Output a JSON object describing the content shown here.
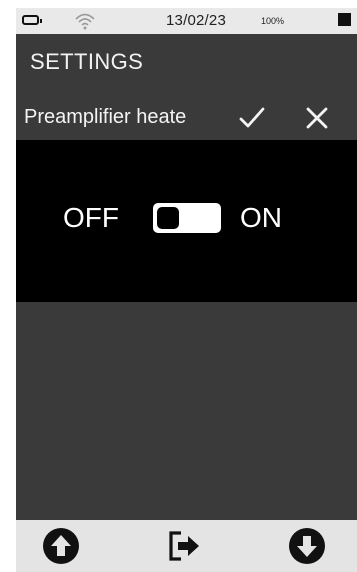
{
  "status_bar": {
    "date": "13/02/23",
    "battery_level": "100%",
    "icons": [
      "battery-icon",
      "wifi-icon",
      "stop-square-icon"
    ]
  },
  "header": {
    "title": "SETTINGS"
  },
  "editor": {
    "field_name": "Preamplifier heate",
    "confirm_icon": "check-icon",
    "cancel_icon": "close-icon"
  },
  "toggle": {
    "off_label": "OFF",
    "on_label": "ON",
    "state": "off"
  },
  "bottom_nav": {
    "icons": [
      "arrow-up-circle-icon",
      "exit-icon",
      "arrow-down-circle-icon"
    ]
  },
  "colors": {
    "screen_bg": "#3a3a3a",
    "panel_bg": "#000000",
    "status_bg": "#e9e9e9",
    "nav_bg": "#e4e4e4",
    "text": "#f2f2f2"
  }
}
